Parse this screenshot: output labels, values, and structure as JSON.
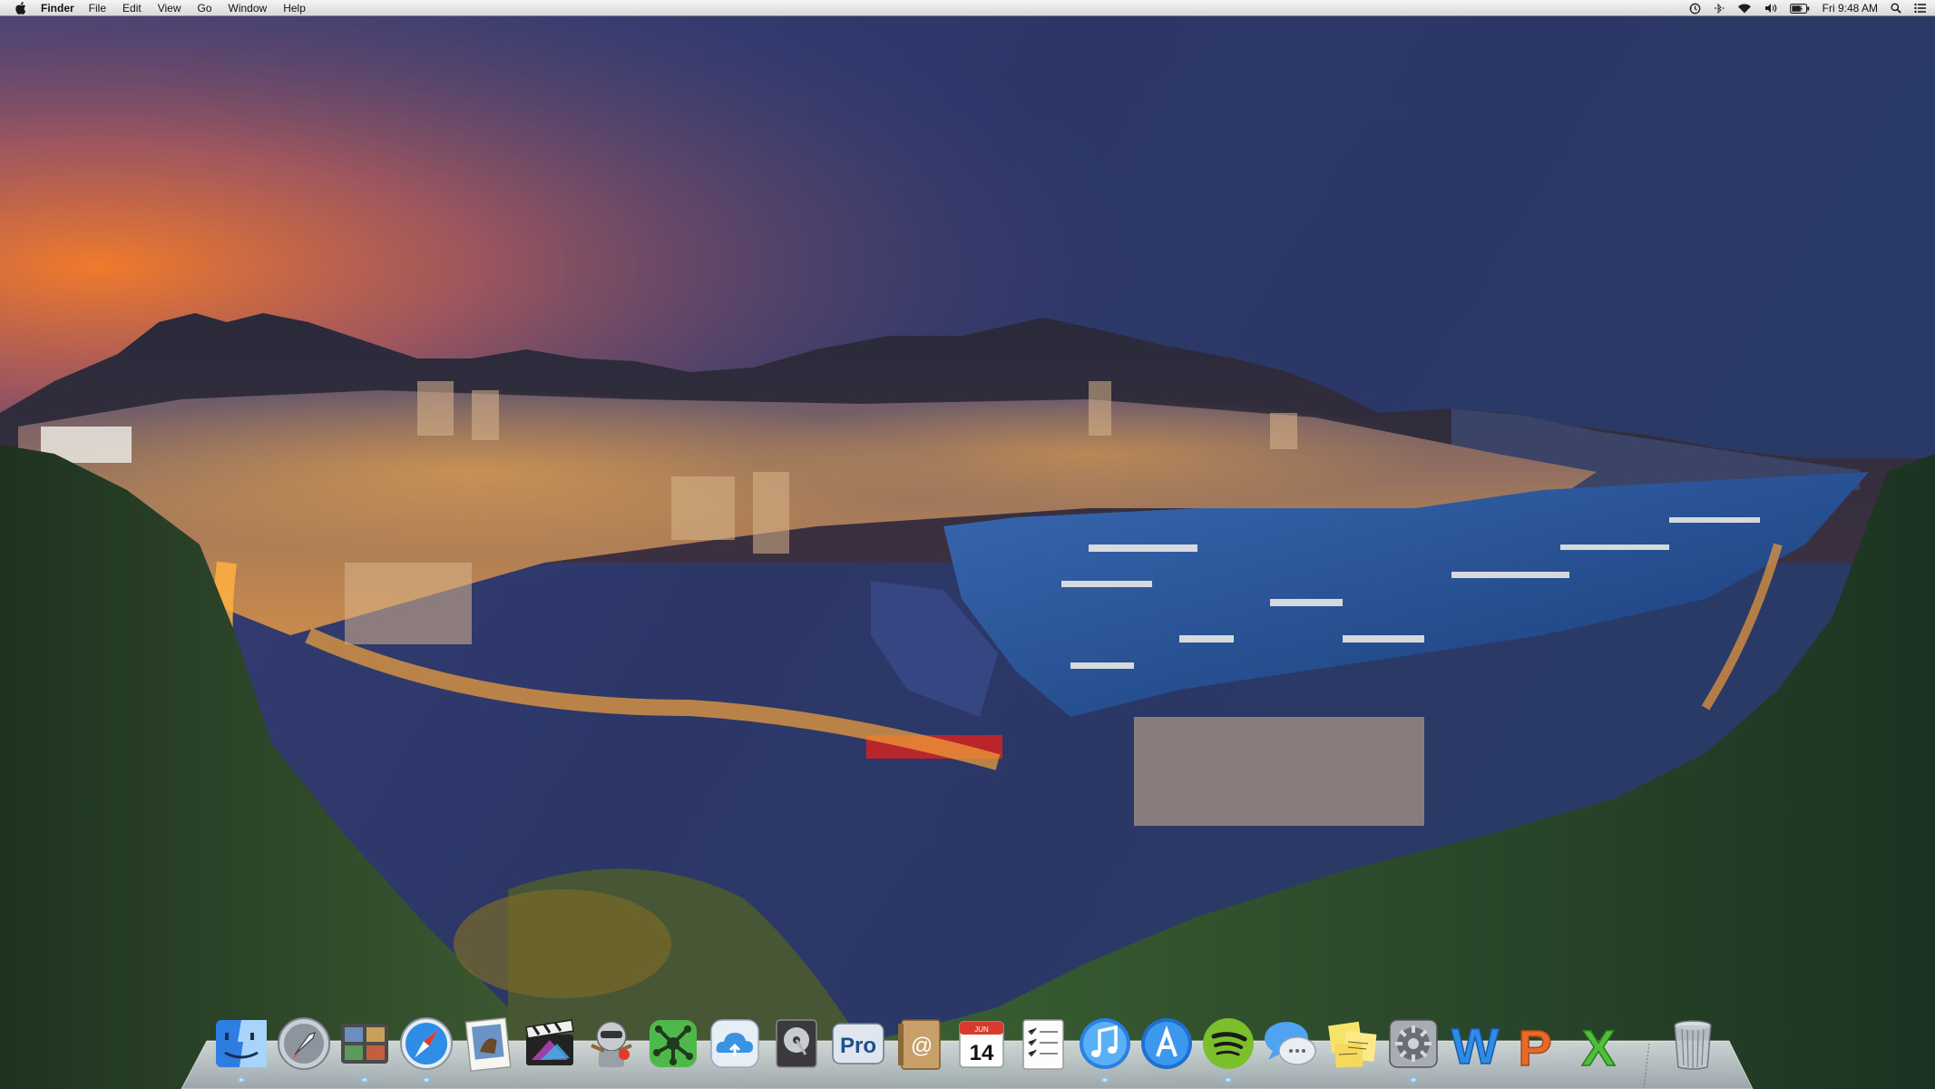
{
  "menubar": {
    "apple_icon": "apple-icon",
    "menus": [
      "Finder",
      "File",
      "Edit",
      "View",
      "Go",
      "Window",
      "Help"
    ],
    "status_icons": [
      "time-machine-icon",
      "bluetooth-icon",
      "wifi-icon",
      "volume-icon",
      "battery-icon"
    ],
    "clock": "Fri 9:48 AM",
    "spotlight_icon": "spotlight-icon",
    "notification_icon": "notification-center-icon"
  },
  "dock": {
    "apps": [
      {
        "name": "finder-icon"
      },
      {
        "name": "launchpad-icon"
      },
      {
        "name": "photo-browser-icon"
      },
      {
        "name": "safari-icon"
      },
      {
        "name": "preview-icon"
      },
      {
        "name": "final-cut-pro-icon"
      },
      {
        "name": "automator-icon"
      },
      {
        "name": "mindmap-icon"
      },
      {
        "name": "icloud-icon"
      },
      {
        "name": "disk-utility-icon"
      },
      {
        "name": "pro-app-icon",
        "label": "Pro"
      },
      {
        "name": "mail-icon"
      },
      {
        "name": "calendar-icon",
        "month": "JUN",
        "day": "14"
      },
      {
        "name": "reminders-icon"
      },
      {
        "name": "itunes-icon"
      },
      {
        "name": "app-store-icon"
      },
      {
        "name": "spotify-icon"
      },
      {
        "name": "messages-icon"
      },
      {
        "name": "stickies-icon"
      },
      {
        "name": "system-preferences-icon"
      },
      {
        "name": "word-icon",
        "label": "W"
      },
      {
        "name": "powerpoint-icon",
        "label": "P"
      },
      {
        "name": "excel-icon",
        "label": "X"
      },
      {
        "name": "trash-icon"
      }
    ]
  },
  "colors": {
    "sky_top": "#2c3563",
    "sky_horizon": "#e06a2c",
    "city_lights": "#f0a040",
    "harbor_water": "#1c4a8a",
    "foliage": "#2d4a2a"
  }
}
